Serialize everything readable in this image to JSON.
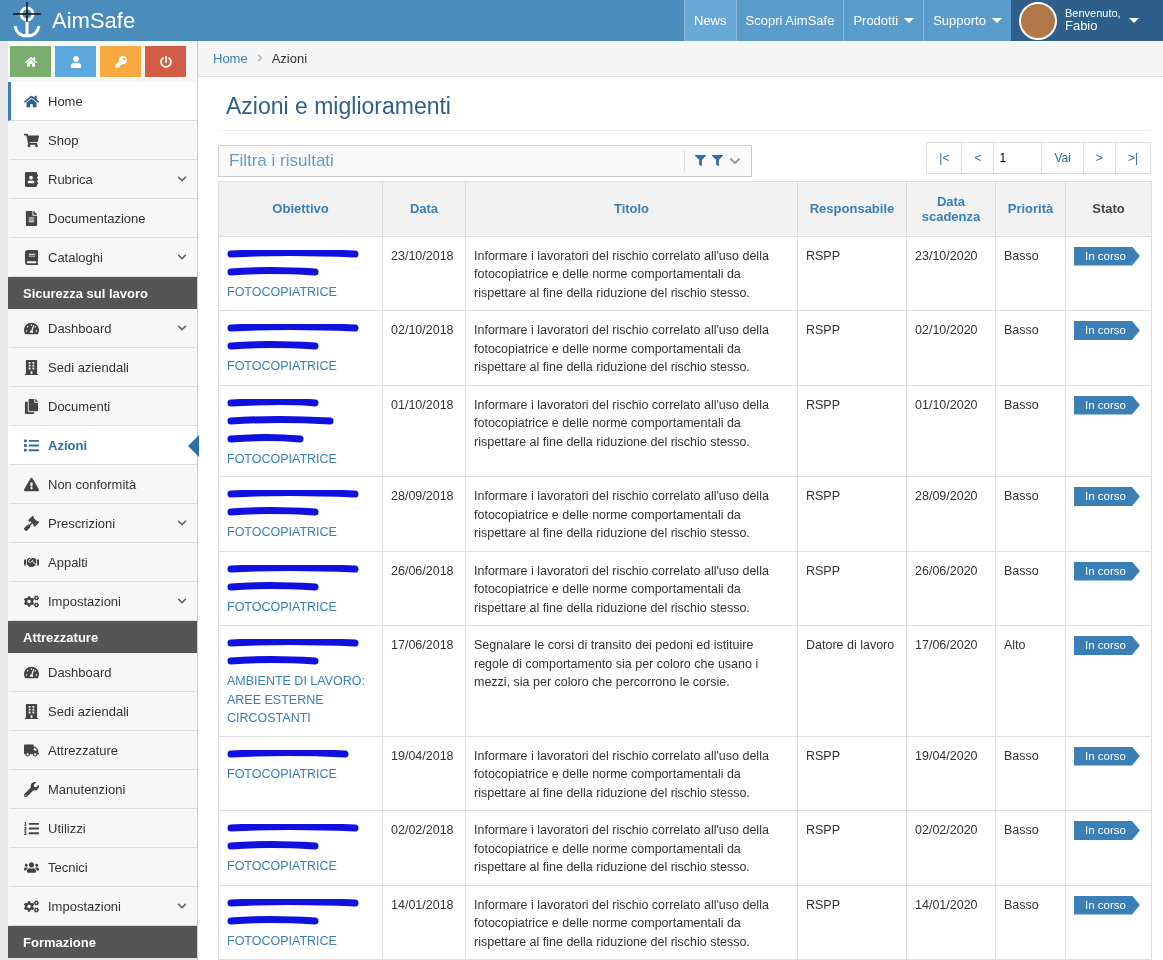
{
  "brand": {
    "name": "AimSafe"
  },
  "topnav": [
    {
      "label": "News",
      "selected": true,
      "dropdown": false
    },
    {
      "label": "Scopri AimSafe",
      "selected": false,
      "dropdown": false
    },
    {
      "label": "Prodotti",
      "selected": false,
      "dropdown": true
    },
    {
      "label": "Supporto",
      "selected": false,
      "dropdown": true
    }
  ],
  "user": {
    "greeting": "Benvenuto,",
    "name": "Fabio"
  },
  "quick_buttons": [
    {
      "kind": "home"
    },
    {
      "kind": "user"
    },
    {
      "kind": "key"
    },
    {
      "kind": "power"
    }
  ],
  "sidebar": [
    {
      "items": [
        {
          "label": "Home",
          "selected": false,
          "active": true,
          "expandable": false
        },
        {
          "label": "Shop",
          "selected": false,
          "active": false,
          "expandable": false
        },
        {
          "label": "Rubrica",
          "selected": false,
          "active": false,
          "expandable": true
        },
        {
          "label": "Documentazione",
          "selected": false,
          "active": false,
          "expandable": false
        },
        {
          "label": "Cataloghi",
          "selected": false,
          "active": false,
          "expandable": true
        }
      ]
    },
    {
      "heading": "Sicurezza sul lavoro",
      "items": [
        {
          "label": "Dashboard",
          "selected": false,
          "active": false,
          "expandable": true
        },
        {
          "label": "Sedi aziendali",
          "selected": false,
          "active": false,
          "expandable": false
        },
        {
          "label": "Documenti",
          "selected": false,
          "active": false,
          "expandable": false
        },
        {
          "label": "Azioni",
          "selected": true,
          "active": false,
          "expandable": false
        },
        {
          "label": "Non conformità",
          "selected": false,
          "active": false,
          "expandable": false
        },
        {
          "label": "Prescrizioni",
          "selected": false,
          "active": false,
          "expandable": true
        },
        {
          "label": "Appalti",
          "selected": false,
          "active": false,
          "expandable": false
        },
        {
          "label": "Impostazioni",
          "selected": false,
          "active": false,
          "expandable": true
        }
      ]
    },
    {
      "heading": "Attrezzature",
      "items": [
        {
          "label": "Dashboard",
          "selected": false,
          "active": false,
          "expandable": false
        },
        {
          "label": "Sedi aziendali",
          "selected": false,
          "active": false,
          "expandable": false
        },
        {
          "label": "Attrezzature",
          "selected": false,
          "active": false,
          "expandable": false
        },
        {
          "label": "Manutenzioni",
          "selected": false,
          "active": false,
          "expandable": false
        },
        {
          "label": "Utilizzi",
          "selected": false,
          "active": false,
          "expandable": false
        },
        {
          "label": "Tecnici",
          "selected": false,
          "active": false,
          "expandable": false
        },
        {
          "label": "Impostazioni",
          "selected": false,
          "active": false,
          "expandable": true
        }
      ]
    },
    {
      "heading": "Formazione"
    }
  ],
  "breadcrumb": [
    "Home",
    "Azioni"
  ],
  "page_title": "Azioni e miglioramenti",
  "filter": {
    "placeholder": "Filtra i risultati"
  },
  "pager": {
    "first": "|<",
    "prev": "<",
    "page": "1",
    "go": "Vai",
    "next": ">",
    "last": ">|"
  },
  "table": {
    "columns": [
      {
        "label": "Obiettivo",
        "sortable": true
      },
      {
        "label": "Data",
        "sortable": true
      },
      {
        "label": "Titolo",
        "sortable": true
      },
      {
        "label": "Responsabile",
        "sortable": true
      },
      {
        "label": "Data scadenza",
        "sortable": true
      },
      {
        "label": "Priorità",
        "sortable": true
      },
      {
        "label": "Stato",
        "sortable": false
      }
    ],
    "rows": [
      {
        "kind": "two-line",
        "category": "FOTOCOPIATRICE",
        "date": "23/10/2018",
        "title": "Informare i lavoratori del rischio correlato all'uso della fotocopiatrice e delle norme comportamentali da rispettare al fine della riduzione del rischio stesso.",
        "owner": "RSPP",
        "due": "23/10/2020",
        "priority": "Basso",
        "status": "In corso"
      },
      {
        "kind": "two-line",
        "category": "FOTOCOPIATRICE",
        "date": "02/10/2018",
        "title": "Informare i lavoratori del rischio correlato all'uso della fotocopiatrice e delle norme comportamentali da rispettare al fine della riduzione del rischio stesso.",
        "owner": "RSPP",
        "due": "02/10/2020",
        "priority": "Basso",
        "status": "In corso"
      },
      {
        "kind": "three-line",
        "category": "FOTOCOPIATRICE",
        "date": "01/10/2018",
        "title": "Informare i lavoratori del rischio correlato all'uso della fotocopiatrice e delle norme comportamentali da rispettare al fine della riduzione del rischio stesso.",
        "owner": "RSPP",
        "due": "01/10/2020",
        "priority": "Basso",
        "status": "In corso"
      },
      {
        "kind": "two-line",
        "category": "FOTOCOPIATRICE",
        "date": "28/09/2018",
        "title": "Informare i lavoratori del rischio correlato all'uso della fotocopiatrice e delle norme comportamentali da rispettare al fine della riduzione del rischio stesso.",
        "owner": "RSPP",
        "due": "28/09/2020",
        "priority": "Basso",
        "status": "In corso"
      },
      {
        "kind": "two-line",
        "category": "FOTOCOPIATRICE",
        "date": "26/06/2018",
        "title": "Informare i lavoratori del rischio correlato all'uso della fotocopiatrice e delle norme comportamentali da rispettare al fine della riduzione del rischio stesso.",
        "owner": "RSPP",
        "due": "26/06/2020",
        "priority": "Basso",
        "status": "In corso"
      },
      {
        "kind": "two-line",
        "category": "AMBIENTE DI LAVORO: AREE ESTERNE CIRCOSTANTI",
        "date": "17/06/2018",
        "title": "Segnalare le corsi di transito dei pedoni ed istituire regole di comportamento sia per coloro che usano i mezzi, sia per coloro che percorrono le corsie.",
        "owner": "Datore di lavoro",
        "due": "17/06/2020",
        "priority": "Alto",
        "status": "In corso"
      },
      {
        "kind": "one-line",
        "category": "FOTOCOPIATRICE",
        "date": "19/04/2018",
        "title": "Informare i lavoratori del rischio correlato all'uso della fotocopiatrice e delle norme comportamentali da rispettare al fine della riduzione del rischio stesso.",
        "owner": "RSPP",
        "due": "19/04/2020",
        "priority": "Basso",
        "status": "In corso"
      },
      {
        "kind": "two-line",
        "category": "FOTOCOPIATRICE",
        "date": "02/02/2018",
        "title": "Informare i lavoratori del rischio correlato all'uso della fotocopiatrice e delle norme comportamentali da rispettare al fine della riduzione del rischio stesso.",
        "owner": "RSPP",
        "due": "02/02/2020",
        "priority": "Basso",
        "status": "In corso"
      },
      {
        "kind": "two-line",
        "category": "FOTOCOPIATRICE",
        "date": "14/01/2018",
        "title": "Informare i lavoratori del rischio correlato all'uso della fotocopiatrice e delle norme comportamentali da rispettare al fine della riduzione del rischio stesso.",
        "owner": "RSPP",
        "due": "14/01/2020",
        "priority": "Basso",
        "status": "In corso"
      }
    ]
  }
}
